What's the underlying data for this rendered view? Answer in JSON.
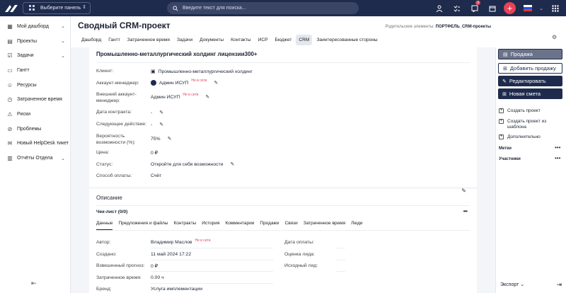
{
  "topbar": {
    "panel_select": "Выберите панель",
    "search_placeholder": "Введите текст для поиска...",
    "notif_badge": "3"
  },
  "sidebar": {
    "items": [
      {
        "label": "Мой дашборд",
        "chev": true
      },
      {
        "label": "Проекты",
        "chev": true
      },
      {
        "label": "Задачи",
        "chev": true
      },
      {
        "label": "Гантт",
        "chev": false
      },
      {
        "label": "Ресурсы",
        "chev": false
      },
      {
        "label": "Затраченное время",
        "chev": false
      },
      {
        "label": "Риски",
        "chev": false
      },
      {
        "label": "Проблемы",
        "chev": false
      },
      {
        "label": "Новый HelpDesk тикет",
        "chev": false
      },
      {
        "label": "Отчёты Отдела",
        "chev": true
      }
    ]
  },
  "page": {
    "title": "Сводный CRM-проект",
    "parent_label": "Родительские элементы:",
    "parent_value": "ПОРТФЕЛЬ_CRM-проекты",
    "tabs": [
      "Дашборд",
      "Гантт",
      "Затраченное время",
      "Задачи",
      "Документы",
      "Контакты",
      "ИСР",
      "Бюджет",
      "CRM",
      "Заинтересованные стороны"
    ],
    "active_tab": "CRM"
  },
  "deal": {
    "title": "Промышленно-металлургический холдинг лицензии300+",
    "client_label": "Клиент:",
    "client_value": "Промышленно-металлургический холдинг",
    "manager_label": "Аккаунт-менеджер:",
    "manager_value": "Админ ИСУП",
    "manager_tag": "Не в сети",
    "ext_manager_label": "Внешний аккаунт-менеджер:",
    "ext_manager_value": "Админ ИСУП",
    "ext_manager_tag": "Не в сети",
    "contract_date_label": "Дата контракта:",
    "contract_date_value": "-",
    "next_action_label": "Следующее действие:",
    "next_action_value": "-",
    "probability_label": "Вероятность возможности (%):",
    "probability_value": "75%",
    "price_label": "Цена:",
    "price_value": "0 ₽",
    "status_label": "Статус:",
    "status_value": "Откройте для себя возможности",
    "payment_label": "Способ оплаты:",
    "payment_value": "Счёт"
  },
  "description": {
    "title": "Описание",
    "checklist": "Чек-лист (0/0)",
    "subtabs": [
      "Данные",
      "Предложения и файлы",
      "Контракты",
      "История",
      "Комментарии",
      "Продажи",
      "Связи",
      "Затраченное время",
      "Люди"
    ],
    "left": [
      {
        "label": "Автор:",
        "value": "Владимир Маслов",
        "tag": "Не в сети"
      },
      {
        "label": "Создано:",
        "value": "11 май 2024 17:22",
        "tag": ""
      },
      {
        "label": "Взвешенный прогноз:",
        "value": "0 ₽",
        "tag": ""
      },
      {
        "label": "Затраченное время:",
        "value": "0.00 ч",
        "tag": ""
      },
      {
        "label": "Бренд:",
        "value": "Услуга имплементации",
        "tag": ""
      }
    ],
    "right": [
      {
        "label": "Дата оплаты:",
        "value": ""
      },
      {
        "label": "Оценка лида:",
        "value": ""
      },
      {
        "label": "Исходный лид:",
        "value": ""
      }
    ]
  },
  "right_panel": {
    "sale": "Продажа",
    "add_sale": "Добавить продажу",
    "edit": "Редактировать",
    "new_estimate": "Новая смета",
    "create_project": "Создать проект",
    "create_from_template": "Создать проект из шаблона",
    "additional": "Дополнительно",
    "tags": "Метки",
    "participants": "Участники",
    "export": "Экспорт"
  }
}
